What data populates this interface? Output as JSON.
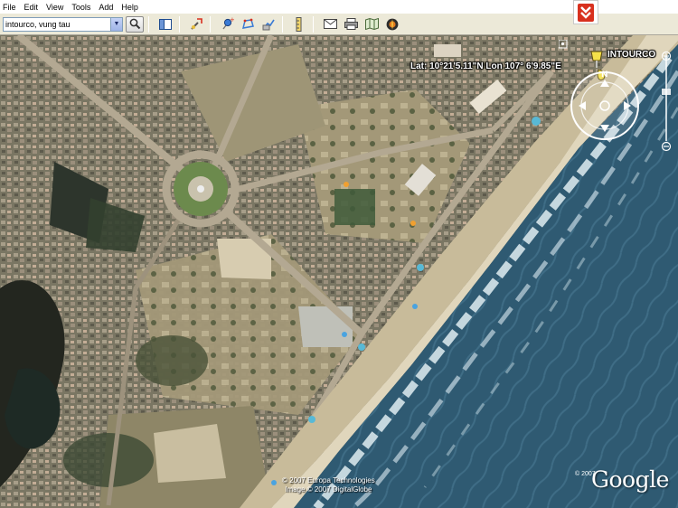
{
  "menu": {
    "items": [
      "File",
      "Edit",
      "View",
      "Tools",
      "Add",
      "Help"
    ]
  },
  "toolbar": {
    "search_value": "intourco, vung tau",
    "buttons": [
      {
        "name": "search-icon"
      },
      {
        "name": "sidebar-toggle-icon"
      },
      {
        "name": "move-tool-icon"
      },
      {
        "name": "add-placemark-icon"
      },
      {
        "name": "add-polygon-icon"
      },
      {
        "name": "add-path-icon"
      },
      {
        "name": "ruler-icon"
      },
      {
        "name": "email-icon"
      },
      {
        "name": "print-icon"
      },
      {
        "name": "map-view-icon"
      },
      {
        "name": "maps-icon"
      }
    ],
    "collapse_icon": "double-chevron-down-icon"
  },
  "map": {
    "coordinates": "Lat: 10°21'5.11\"N Lon 107° 6'9.85\"E",
    "placemark_label": "INTOURCO",
    "copyright": [
      "© 2007 Europa Technologies",
      "Image © 2007 DigitalGlobe"
    ],
    "logo_small_text": "© 2007",
    "logo": "Google",
    "compass_label": "N"
  },
  "colors": {
    "sea": "#2f5a72",
    "surf": "#d6e4ea",
    "sand": "#c8bb9a",
    "urban": "#7d7a68",
    "vegetation": "#3b4a35",
    "accent_red": "#d8301e"
  }
}
